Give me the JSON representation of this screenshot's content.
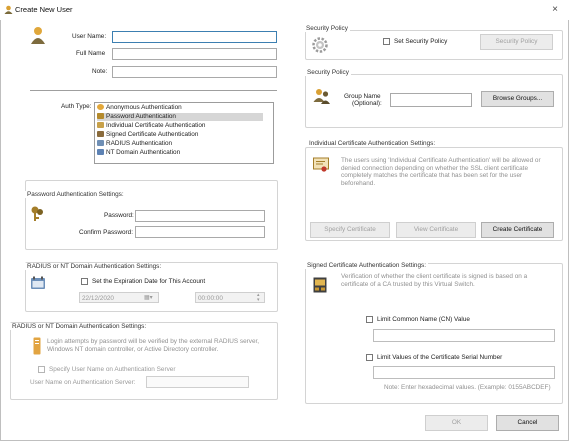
{
  "window": {
    "title": "Create New User",
    "close_glyph": "×"
  },
  "user": {
    "user_name_label": "User Name:",
    "full_name_label": "Full Name",
    "note_label": "Note:",
    "user_name_value": "",
    "full_name_value": "",
    "note_value": ""
  },
  "auth": {
    "label": "Auth Type:",
    "options": [
      {
        "label": "Anonymous Authentication",
        "icon": "anonymous-icon",
        "color": "#e3a83b"
      },
      {
        "label": "Password Authentication",
        "icon": "key-icon",
        "color": "#b48a2c"
      },
      {
        "label": "Individual Certificate Authentication",
        "icon": "certificate-icon",
        "color": "#c8a14a"
      },
      {
        "label": "Signed Certificate Authentication",
        "icon": "signed-certificate-icon",
        "color": "#8a6b3c"
      },
      {
        "label": "RADIUS Authentication",
        "icon": "radius-icon",
        "color": "#6f8fb5"
      },
      {
        "label": "NT Domain Authentication",
        "icon": "nt-domain-icon",
        "color": "#5d82b4"
      }
    ],
    "selected_index": 1
  },
  "password_settings": {
    "title": "Password Authentication Settings:",
    "password_label": "Password:",
    "confirm_label": "Confirm Password:",
    "password_value": "",
    "confirm_value": ""
  },
  "radius_expiration": {
    "title": "RADIUS or NT Domain Authentication Settings:",
    "checkbox_label": "Set the Expiration Date for This Account",
    "date_value": "22/12/2020",
    "time_value": "00:00:00"
  },
  "radius_settings": {
    "title": "RADIUS or NT Domain Authentication Settings:",
    "description": "Login attempts by password will be verified by the external RADIUS server, Windows NT domain controller, or Active Directory controller.",
    "checkbox_label": "Specify User Name on Authentication Server",
    "server_name_label": "User Name on Authentication Server:",
    "server_name_value": ""
  },
  "security_policy": {
    "title": "Security Policy",
    "checkbox_label": "Set Security Policy",
    "button_label": "Security Policy"
  },
  "security_group": {
    "title": "Security Policy",
    "group_name_label": "Group Name",
    "group_name_sub": "(Optional):",
    "group_name_value": "",
    "browse_button": "Browse Groups..."
  },
  "individual_cert": {
    "title": "Individual Certificate Authentication Settings:",
    "description": "The users using 'Individual Certificate Authentication' will be allowed or denied connection depending on whether the SSL client certificate completely matches the certificate that has been set for the user beforehand.",
    "specify_button": "Specify Certificate",
    "view_button": "View Certificate",
    "create_button": "Create Certificate"
  },
  "signed_cert": {
    "title": "Signed Certificate Authentication Settings:",
    "description": "Verification of whether the client certificate is signed is based on a certificate of a CA trusted by this Virtual Switch.",
    "cn_checkbox_label": "Limit Common Name (CN) Value",
    "cn_value": "",
    "serial_checkbox_label": "Limit Values of the Certificate Serial Number",
    "serial_value": "",
    "serial_note": "Note: Enter hexadecimal values. (Example: 0155ABCDEF)"
  },
  "footer": {
    "ok_button": "OK",
    "cancel_button": "Cancel"
  }
}
